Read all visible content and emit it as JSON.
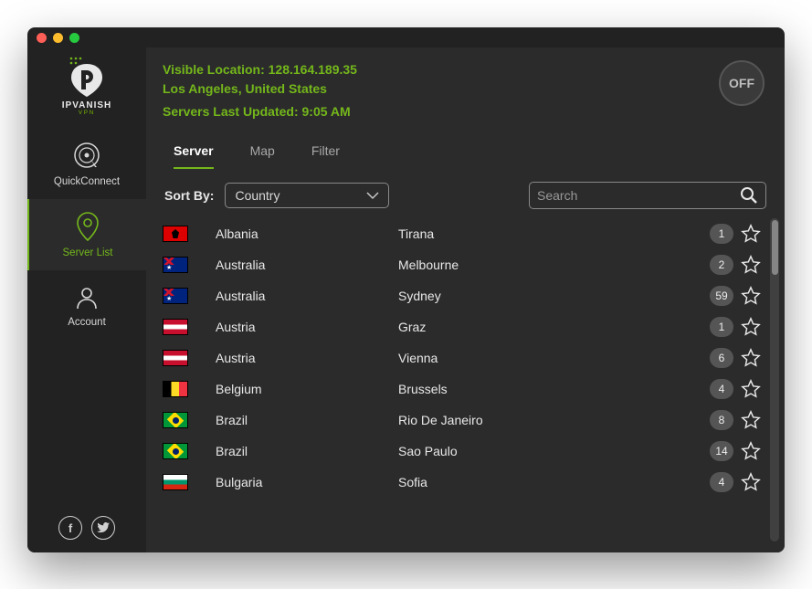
{
  "brand": {
    "name": "IPVANISH",
    "sub": "VPN"
  },
  "header": {
    "location_line": "Visible Location: 128.164.189.35",
    "city_line": "Los Angeles, United States",
    "updated_line": "Servers Last Updated: 9:05 AM",
    "power_label": "OFF"
  },
  "sidebar": {
    "items": [
      {
        "label": "QuickConnect"
      },
      {
        "label": "Server List"
      },
      {
        "label": "Account"
      }
    ]
  },
  "tabs": [
    {
      "label": "Server",
      "active": true
    },
    {
      "label": "Map",
      "active": false
    },
    {
      "label": "Filter",
      "active": false
    }
  ],
  "controls": {
    "sort_label": "Sort By:",
    "sort_value": "Country",
    "search_placeholder": "Search"
  },
  "servers": [
    {
      "country": "Albania",
      "city": "Tirana",
      "count": "1",
      "flag": "al"
    },
    {
      "country": "Australia",
      "city": "Melbourne",
      "count": "2",
      "flag": "au"
    },
    {
      "country": "Australia",
      "city": "Sydney",
      "count": "59",
      "flag": "au"
    },
    {
      "country": "Austria",
      "city": "Graz",
      "count": "1",
      "flag": "at"
    },
    {
      "country": "Austria",
      "city": "Vienna",
      "count": "6",
      "flag": "at"
    },
    {
      "country": "Belgium",
      "city": "Brussels",
      "count": "4",
      "flag": "be"
    },
    {
      "country": "Brazil",
      "city": "Rio De Janeiro",
      "count": "8",
      "flag": "br"
    },
    {
      "country": "Brazil",
      "city": "Sao Paulo",
      "count": "14",
      "flag": "br"
    },
    {
      "country": "Bulgaria",
      "city": "Sofia",
      "count": "4",
      "flag": "bg"
    }
  ]
}
